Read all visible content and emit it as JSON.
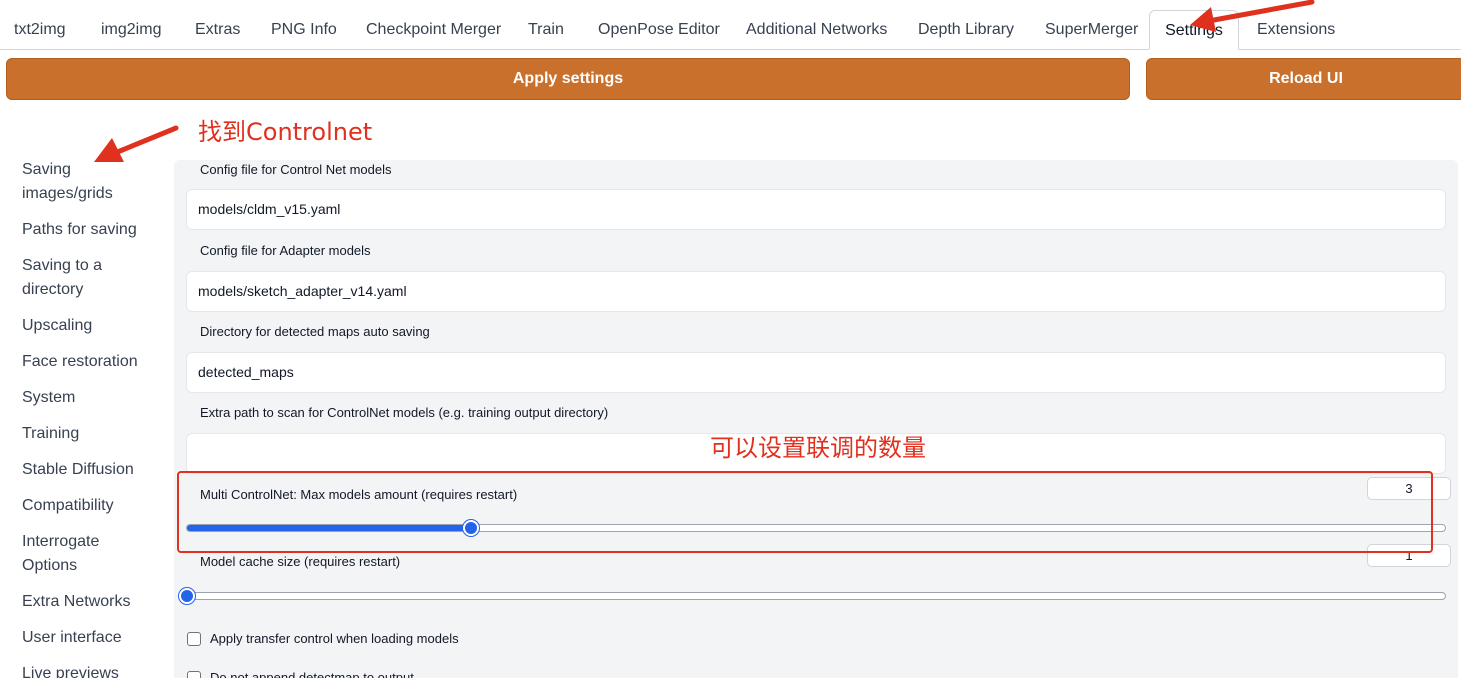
{
  "tabs": [
    {
      "label": "txt2img"
    },
    {
      "label": "img2img"
    },
    {
      "label": "Extras"
    },
    {
      "label": "PNG Info"
    },
    {
      "label": "Checkpoint Merger"
    },
    {
      "label": "Train"
    },
    {
      "label": "OpenPose Editor"
    },
    {
      "label": "Additional Networks"
    },
    {
      "label": "Depth Library"
    },
    {
      "label": "SuperMerger"
    },
    {
      "label": "Settings",
      "active": true
    },
    {
      "label": "Extensions"
    }
  ],
  "toolbar": {
    "apply_label": "Apply settings",
    "reload_label": "Reload UI"
  },
  "sidebar": {
    "items": [
      {
        "label": "Saving images/grids"
      },
      {
        "label": "Paths for saving"
      },
      {
        "label": "Saving to a directory"
      },
      {
        "label": "Upscaling"
      },
      {
        "label": "Face restoration"
      },
      {
        "label": "System"
      },
      {
        "label": "Training"
      },
      {
        "label": "Stable Diffusion"
      },
      {
        "label": "Compatibility"
      },
      {
        "label": "Interrogate Options"
      },
      {
        "label": "Extra Networks"
      },
      {
        "label": "User interface"
      },
      {
        "label": "Live previews"
      }
    ]
  },
  "settings": {
    "config_cn": {
      "label": "Config file for Control Net models",
      "value": "models/cldm_v15.yaml"
    },
    "config_adapter": {
      "label": "Config file for Adapter models",
      "value": "models/sketch_adapter_v14.yaml"
    },
    "detected_dir": {
      "label": "Directory for detected maps auto saving",
      "value": "detected_maps"
    },
    "extra_path": {
      "label": "Extra path to scan for ControlNet models (e.g. training output directory)",
      "value": ""
    },
    "multi_cn": {
      "label": "Multi ControlNet: Max models amount (requires restart)",
      "value": "3",
      "slider_fraction": 0.226
    },
    "cache_size": {
      "label": "Model cache size (requires restart)",
      "value": "1",
      "slider_fraction": 0.0
    },
    "transfer_control": {
      "label": "Apply transfer control when loading models",
      "checked": false
    },
    "no_append": {
      "label": "Do not append detectmap to output",
      "checked": false
    }
  },
  "annotations": {
    "find_controlnet": "找到Controlnet",
    "set_count": "可以设置联调的数量",
    "color": "#e0301e"
  },
  "colors": {
    "accent_button": "#c9702c",
    "slider": "#2563eb"
  }
}
